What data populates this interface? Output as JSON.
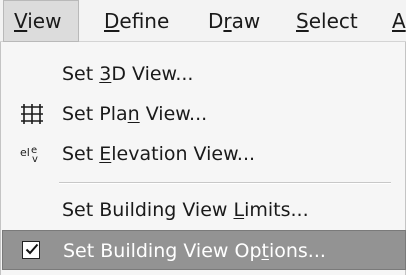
{
  "menubar": {
    "items": [
      {
        "pre": "",
        "key": "V",
        "post": "iew"
      },
      {
        "pre": "",
        "key": "D",
        "post": "efine"
      },
      {
        "pre": "D",
        "key": "r",
        "post": "aw"
      },
      {
        "pre": "",
        "key": "S",
        "post": "elect"
      },
      {
        "pre": "",
        "key": "A",
        "post": ""
      }
    ]
  },
  "menu": {
    "items": [
      {
        "pre": "Set ",
        "key": "3",
        "post": "D View...",
        "icon": ""
      },
      {
        "pre": "Set Pla",
        "key": "n",
        "post": " View...",
        "icon": "plan-grid-icon"
      },
      {
        "pre": "Set ",
        "key": "E",
        "post": "levation View...",
        "icon": "elevation-icon"
      },
      {
        "pre": "Set Building View ",
        "key": "L",
        "post": "imits...",
        "icon": ""
      },
      {
        "pre": "Set Building View Op",
        "key": "t",
        "post": "ions...",
        "icon": "checkbox-checked-icon",
        "checked": true
      }
    ]
  },
  "colors": {
    "menubar_bg": "#f3f3f3",
    "menu_bg": "#f6f6f6",
    "highlight_bg": "#939393",
    "highlight_text": "#ffffff"
  }
}
